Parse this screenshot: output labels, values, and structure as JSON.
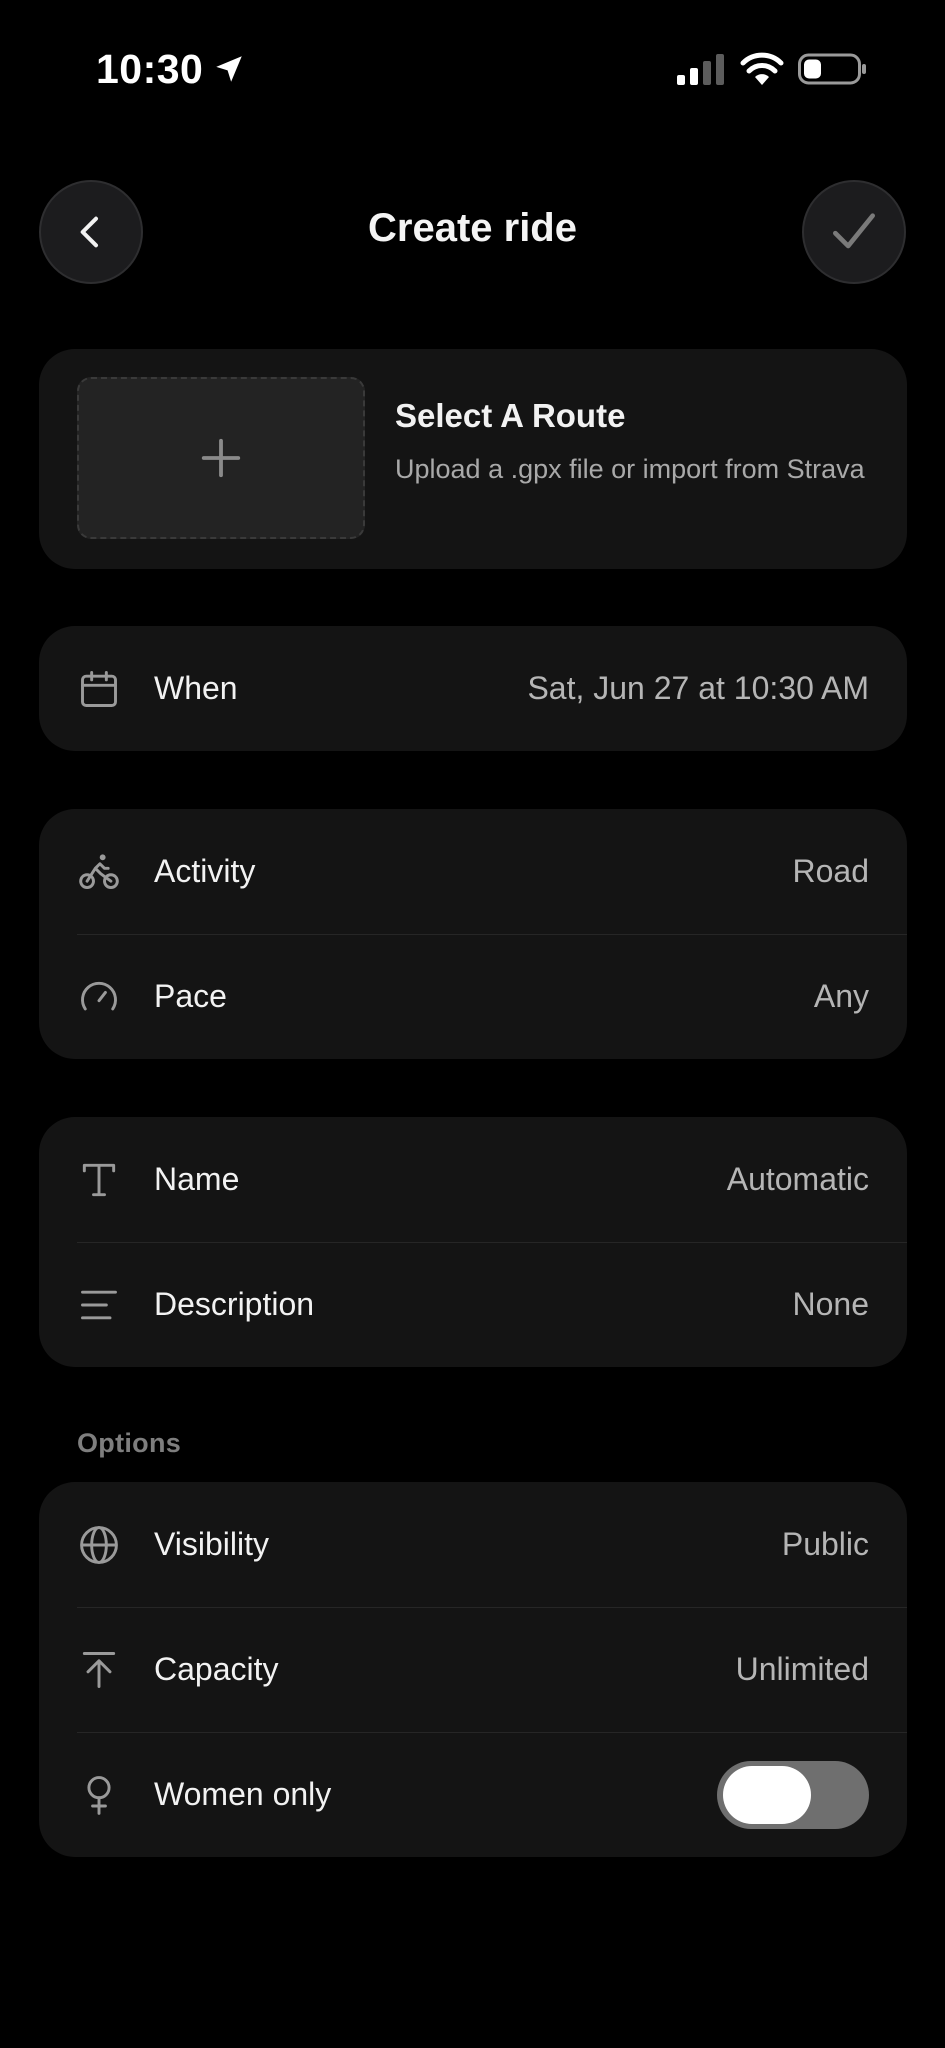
{
  "status_bar": {
    "time": "10:30",
    "icons": [
      "location-arrow-icon",
      "cellular-signal-icon",
      "wifi-icon",
      "battery-icon"
    ]
  },
  "header": {
    "title": "Create ride",
    "back_icon": "chevron-left-icon",
    "confirm_icon": "checkmark-icon"
  },
  "route": {
    "title": "Select A Route",
    "subtitle": "Upload a .gpx file or import from Strava",
    "add_icon": "plus-icon"
  },
  "when": {
    "label": "When",
    "value": "Sat, Jun 27 at 10:30 AM",
    "icon": "calendar-icon"
  },
  "activity_group": {
    "rows": [
      {
        "label": "Activity",
        "value": "Road",
        "icon": "bicycle-icon"
      },
      {
        "label": "Pace",
        "value": "Any",
        "icon": "speedometer-icon"
      }
    ]
  },
  "name_group": {
    "rows": [
      {
        "label": "Name",
        "value": "Automatic",
        "icon": "text-icon"
      },
      {
        "label": "Description",
        "value": "None",
        "icon": "lines-icon"
      }
    ]
  },
  "options": {
    "section_label": "Options",
    "rows": [
      {
        "label": "Visibility",
        "value": "Public",
        "icon": "globe-icon"
      },
      {
        "label": "Capacity",
        "value": "Unlimited",
        "icon": "arrow-up-bar-icon"
      },
      {
        "label": "Women only",
        "value": "",
        "icon": "female-symbol-icon",
        "toggle_on": false
      }
    ]
  },
  "colors": {
    "background": "#000000",
    "card": "#141414",
    "text_primary": "#f2f2f2",
    "text_secondary": "#b5b5b5",
    "toggle_track": "#6f6f6f"
  }
}
